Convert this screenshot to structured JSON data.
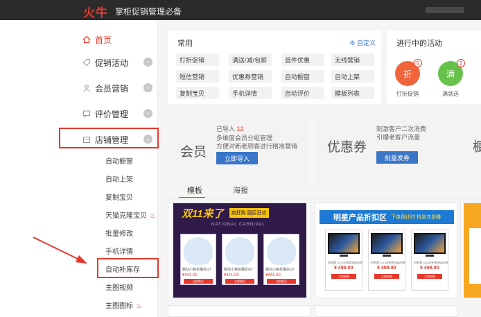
{
  "topbar": {
    "logo": "火牛",
    "title": "掌柜促销管理必备"
  },
  "sidebar": {
    "home": "首页",
    "items": [
      {
        "label": "促销活动"
      },
      {
        "label": "会员营销"
      },
      {
        "label": "评价管理"
      },
      {
        "label": "店铺管理"
      }
    ],
    "sub_items": [
      {
        "label": "自动橱窗"
      },
      {
        "label": "自动上架"
      },
      {
        "label": "复制宝贝"
      },
      {
        "label": "天猫克隆宝贝"
      },
      {
        "label": "批量修改"
      },
      {
        "label": "手机详情"
      },
      {
        "label": "自动补库存"
      },
      {
        "label": "主图视频"
      },
      {
        "label": "主图图标"
      }
    ]
  },
  "common": {
    "title": "常用",
    "custom": "自定义",
    "chips": [
      "打折促销",
      "满送/减/包邮",
      "首件优惠",
      "无线营销",
      "短信营销",
      "优惠券营销",
      "自动橱窗",
      "自动上架",
      "复制宝贝",
      "手机详情",
      "自动评价",
      "模板列表"
    ]
  },
  "activity": {
    "title": "进行中的活动",
    "items": [
      {
        "icon": "折",
        "label": "打折促销",
        "count": "5",
        "color": "#f0643c"
      },
      {
        "icon": "满",
        "label": "满就送",
        "count": "2",
        "color": "#66c24a"
      }
    ]
  },
  "cards": {
    "member": {
      "big": "会员",
      "line1_prefix": "已导入",
      "line1_num": "12",
      "line2": "多维度会员分组管理",
      "line3": "方便对新老顾客进行精准营销",
      "button": "立即导入"
    },
    "coupon": {
      "big": "优惠券",
      "line1": "刺激客户二次消费",
      "line2": "引爆老客户流量",
      "button": "批量发券"
    },
    "third_big": "橱"
  },
  "tabs": {
    "active": "模板",
    "other": "海报"
  },
  "tpl1": {
    "double": "双11来了",
    "tag": "疯狂购 國民狂欢",
    "sub": "NATIONAL CARNIVAL",
    "products": [
      {
        "name": "婴幼小棉花睡衣Q7",
        "price": "¥441.00",
        "btn": "立即购买"
      },
      {
        "name": "婴幼小棉花睡衣Q7",
        "price": "¥441.00",
        "btn": "立即购买"
      },
      {
        "name": "婴幼小棉花睡衣Q7",
        "price": "¥441.00",
        "btn": "立即购买"
      }
    ]
  },
  "tpl2": {
    "title": "明星产品折扣区",
    "sub": "下单倒计时 抢到才是赚",
    "tvs": [
      {
        "name": "阿斯鹿 2016年新款液晶电视",
        "price": "¥ 499.00",
        "btn": "立即抢购"
      },
      {
        "name": "阿斯鹿 2016年新款液晶电视",
        "price": "¥ 499.00",
        "btn": "立即抢购"
      },
      {
        "name": "阿斯鹿 2016年新款液晶电视",
        "price": "¥ 499.00",
        "btn": "立即抢购"
      }
    ]
  }
}
